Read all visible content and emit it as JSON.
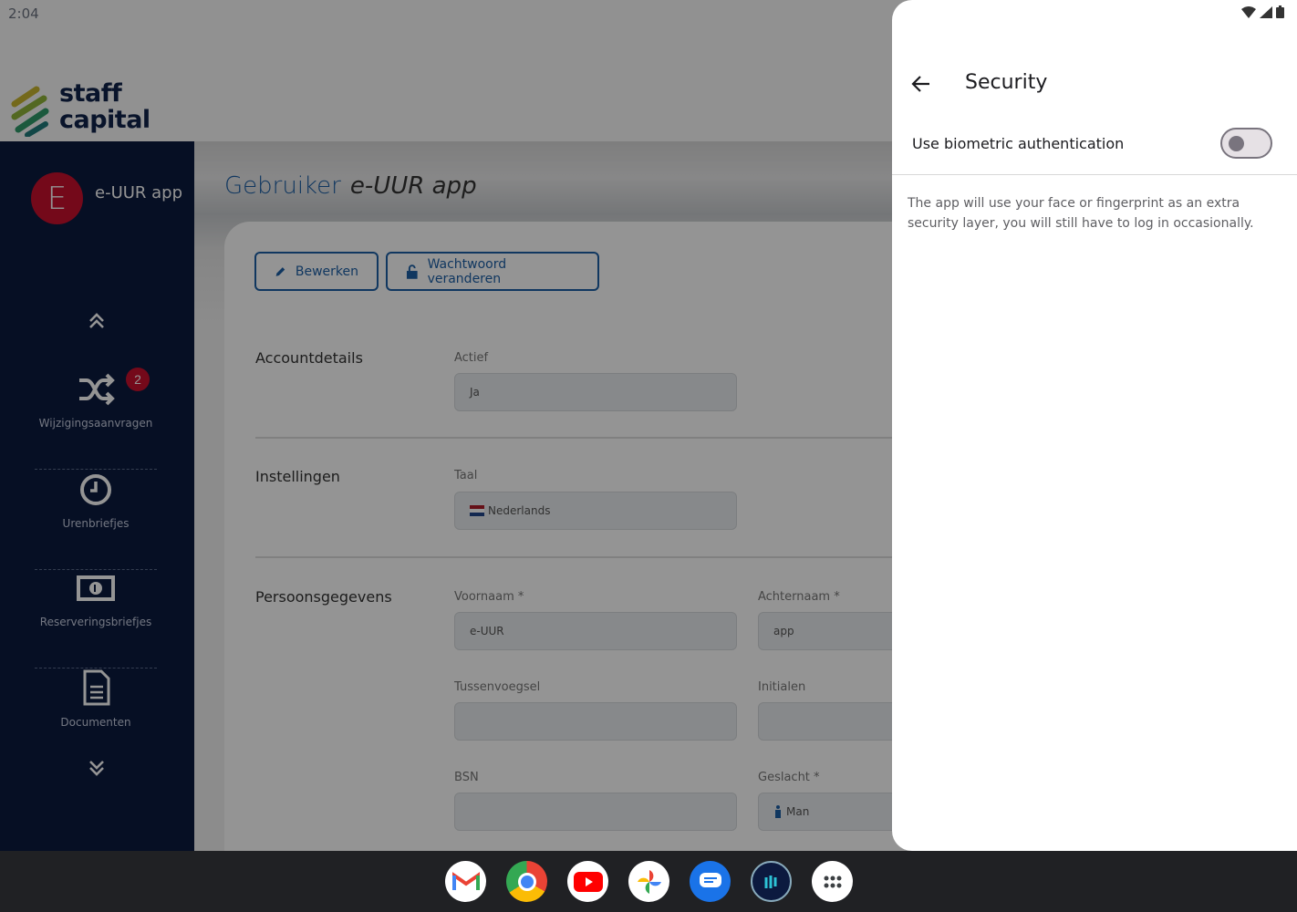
{
  "status_bar": {
    "time": "2:04"
  },
  "app": {
    "logo_text_line1": "staff",
    "logo_text_line2": "capital",
    "user": {
      "initial": "E",
      "name": "e-UUR app"
    },
    "nav": {
      "items": [
        {
          "label": "Wijzigingsaanvragen",
          "icon": "shuffle-icon",
          "badge": "2"
        },
        {
          "label": "Urenbriefjes",
          "icon": "clock-icon"
        },
        {
          "label": "Reserveringsbriefjes",
          "icon": "money-icon"
        },
        {
          "label": "Documenten",
          "icon": "document-icon"
        }
      ]
    },
    "page": {
      "title": "Gebruiker",
      "title_em": "e-UUR app",
      "buttons": {
        "edit": "Bewerken",
        "change_password": "Wachtwoord veranderen"
      },
      "sections": {
        "account": "Accountdetails",
        "settings": "Instellingen",
        "personal": "Persoonsgegevens"
      },
      "fields": {
        "active_label": "Actief",
        "active_value": "Ja",
        "language_label": "Taal",
        "language_value": "Nederlands",
        "firstname_label": "Voornaam *",
        "firstname_value": "e-UUR",
        "lastname_label": "Achternaam *",
        "lastname_value": "app",
        "infix_label": "Tussenvoegsel",
        "initials_label": "Initialen",
        "bsn_label": "BSN",
        "gender_label": "Geslacht *",
        "gender_value": "Man"
      }
    }
  },
  "panel": {
    "title": "Security",
    "biometric_label": "Use biometric authentication",
    "biometric_enabled": false,
    "description": "The app will use your face or fingerprint as an extra security layer, you will still have to log in occasionally."
  },
  "taskbar": {
    "apps": [
      "gmail-icon",
      "chrome-icon",
      "youtube-icon",
      "photos-icon",
      "messages-icon",
      "app-icon",
      "launcher-icon"
    ]
  }
}
